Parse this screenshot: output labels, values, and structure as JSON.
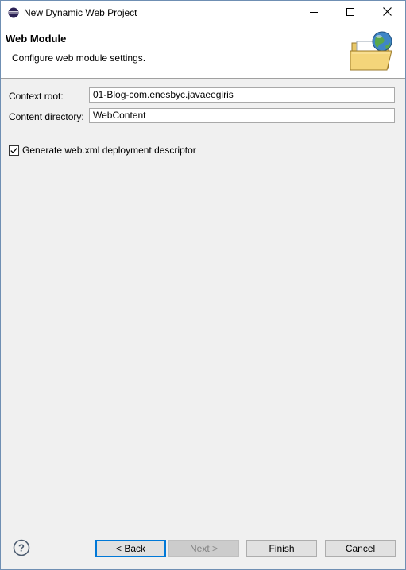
{
  "window": {
    "title": "New Dynamic Web Project",
    "icons": {
      "app": "eclipse-icon",
      "minimize": "minimize-icon",
      "maximize": "maximize-icon",
      "close": "close-icon"
    }
  },
  "banner": {
    "title": "Web Module",
    "description": "Configure web module settings.",
    "image": "folder-globe-icon"
  },
  "form": {
    "context_root": {
      "label": "Context root:",
      "value": "01-Blog-com.enesbyc.javaeegiris"
    },
    "content_directory": {
      "label": "Content directory:",
      "value": "WebContent"
    },
    "generate_descriptor": {
      "label": "Generate web.xml deployment descriptor",
      "checked": true
    }
  },
  "buttons": {
    "help_icon": "help-icon",
    "back": "< Back",
    "next": "Next >",
    "finish": "Finish",
    "cancel": "Cancel"
  },
  "colors": {
    "focus_border": "#0078d7",
    "dialog_bg": "#f0f0f0",
    "window_border": "#6f8fb3"
  }
}
